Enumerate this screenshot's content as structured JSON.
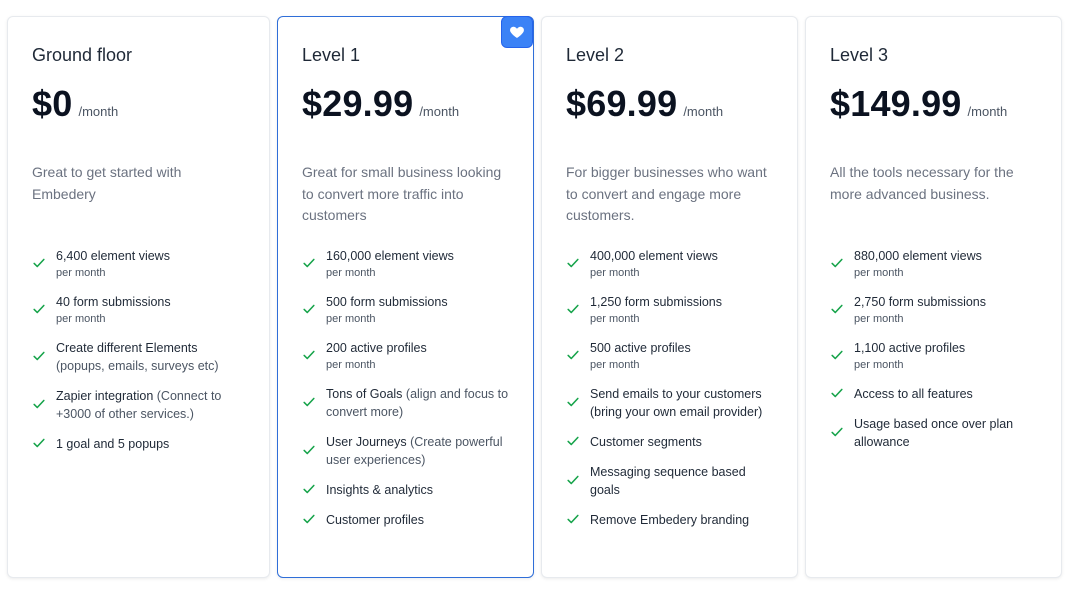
{
  "plans": [
    {
      "name": "Ground floor",
      "price": "$0",
      "period": "/month",
      "description": "Great to get started with Embedery",
      "features": [
        {
          "text": "6,400 element views",
          "sub": "per month"
        },
        {
          "text": "40 form submissions",
          "sub": "per month"
        },
        {
          "text": "Create different Elements",
          "extra": " (popups, emails, surveys etc)"
        },
        {
          "text": "Zapier integration",
          "extra": " (Connect to +3000 of other services.)"
        },
        {
          "text": "1 goal and 5 popups"
        }
      ]
    },
    {
      "name": "Level 1",
      "price": "$29.99",
      "period": "/month",
      "description": "Great for small business looking to convert more traffic into customers",
      "features": [
        {
          "text": "160,000 element views",
          "sub": "per month"
        },
        {
          "text": "500 form submissions",
          "sub": "per month"
        },
        {
          "text": "200 active profiles",
          "sub": "per month"
        },
        {
          "text": "Tons of Goals",
          "extra": " (align and focus to convert more)"
        },
        {
          "text": "User Journeys",
          "extra": " (Create powerful user experiences)"
        },
        {
          "text": "Insights & analytics"
        },
        {
          "text": "Customer profiles"
        }
      ]
    },
    {
      "name": "Level 2",
      "price": "$69.99",
      "period": "/month",
      "description": "For bigger businesses who want to convert and engage more customers.",
      "features": [
        {
          "text": "400,000 element views",
          "sub": "per month"
        },
        {
          "text": "1,250 form submissions",
          "sub": "per month"
        },
        {
          "text": "500 active profiles",
          "sub": "per month"
        },
        {
          "text": "Send emails to your customers (bring your own email provider)"
        },
        {
          "text": "Customer segments"
        },
        {
          "text": "Messaging sequence based goals"
        },
        {
          "text": "Remove Embedery branding"
        }
      ]
    },
    {
      "name": "Level 3",
      "price": "$149.99",
      "period": "/month",
      "description": "All the tools necessary for the more advanced business.",
      "features": [
        {
          "text": "880,000 element views",
          "sub": "per month"
        },
        {
          "text": "2,750 form submissions",
          "sub": "per month"
        },
        {
          "text": "1,100 active profiles",
          "sub": "per month"
        },
        {
          "text": "Access to all features"
        },
        {
          "text": "Usage based once over plan allowance"
        }
      ]
    }
  ],
  "favorite_icon": "heart-icon",
  "colors": {
    "accent": "#3b82f6",
    "featured_border": "#2f6ed8",
    "check": "#16a34a",
    "price": "#0b1220"
  }
}
